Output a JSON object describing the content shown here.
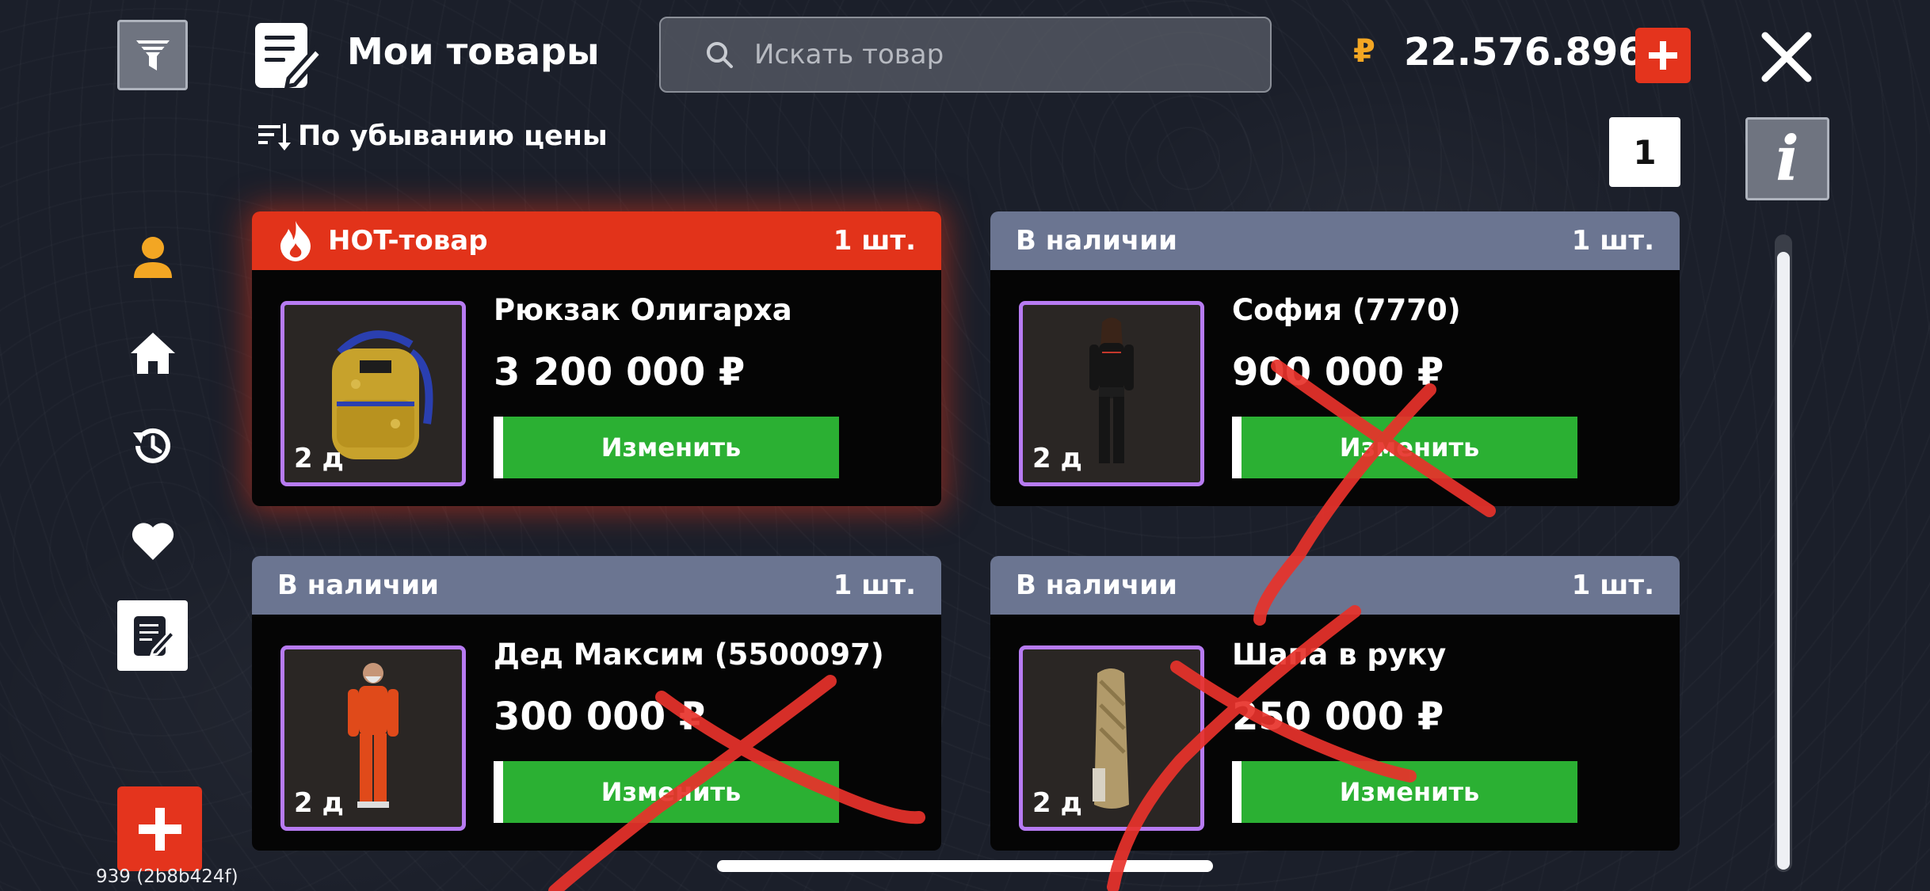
{
  "header": {
    "title": "Мои товары",
    "search_placeholder": "Искать товар",
    "currency_sign": "₽",
    "balance": "22.576.896"
  },
  "sort": {
    "label": "По убыванию цены"
  },
  "pagination": {
    "current_page": "1"
  },
  "info_label": "i",
  "sidebar": {
    "items": [
      {
        "icon": "user-icon",
        "active": false
      },
      {
        "icon": "home-icon",
        "active": false
      },
      {
        "icon": "history-icon",
        "active": false
      },
      {
        "icon": "heart-icon",
        "active": false
      },
      {
        "icon": "my-listings-icon",
        "active": true
      }
    ]
  },
  "version": "939 (2b8b424f)",
  "cards": [
    {
      "status": "HOT-товар",
      "hot": true,
      "qty": "1 шт.",
      "name": "Рюкзак Олигарха",
      "price": "3 200 000 ₽",
      "days": "2 д",
      "button": "Изменить"
    },
    {
      "status": "В наличии",
      "hot": false,
      "qty": "1 шт.",
      "name": "София (7770)",
      "price": "900 000 ₽",
      "days": "2 д",
      "button": "Изменить"
    },
    {
      "status": "В наличии",
      "hot": false,
      "qty": "1 шт.",
      "name": "Дед Максим (5500097)",
      "price": "300 000 ₽",
      "days": "2 д",
      "button": "Изменить"
    },
    {
      "status": "В наличии",
      "hot": false,
      "qty": "1 шт.",
      "name": "Шапа в руку",
      "price": "250 000 ₽",
      "days": "2 д",
      "button": "Изменить"
    }
  ],
  "colors": {
    "accent_red": "#e4341d",
    "button_green": "#2bb033",
    "status_header": "#6b7591",
    "thumb_border": "#b77bf2",
    "currency": "#f3a623",
    "annotation_red": "#e8322b"
  }
}
